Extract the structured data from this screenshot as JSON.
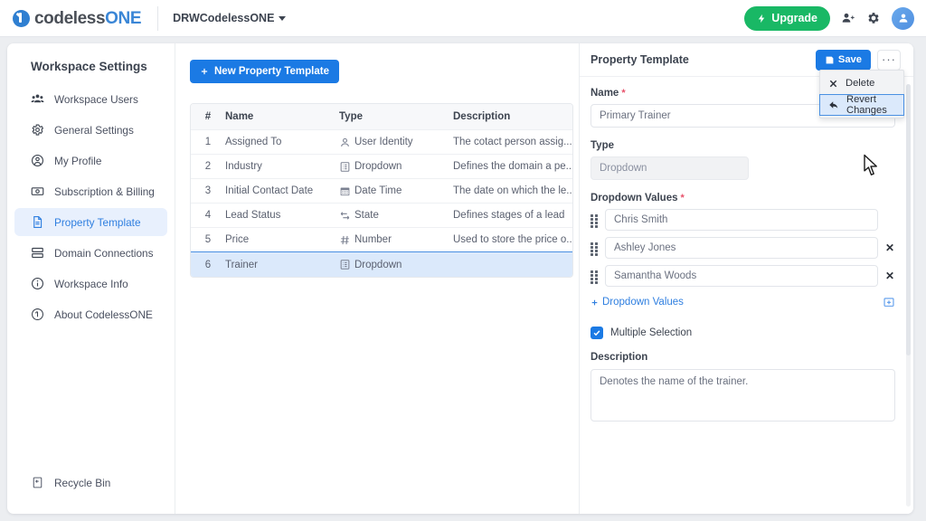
{
  "topbar": {
    "logo_a": "codeless",
    "logo_b": "ONE",
    "logo_icon": "codelessone-logo-icon",
    "workspace_name": "DRWCodelessONE",
    "upgrade_label": "Upgrade",
    "upgrade_icon": "lightning-bolt-icon",
    "invite_icon": "add-user-icon",
    "settings_icon": "gear-icon",
    "avatar_icon": "user-avatar-icon",
    "accent_green": "#19b865",
    "accent_blue": "#1b7ae4"
  },
  "sidebar": {
    "title": "Workspace Settings",
    "items": [
      {
        "label": "Workspace Users",
        "icon": "users-group-icon",
        "active": false
      },
      {
        "label": "General Settings",
        "icon": "gear-icon",
        "active": false
      },
      {
        "label": "My Profile",
        "icon": "user-circle-icon",
        "active": false
      },
      {
        "label": "Subscription & Billing",
        "icon": "banknote-icon",
        "active": false
      },
      {
        "label": "Property Template",
        "icon": "document-icon",
        "active": true
      },
      {
        "label": "Domain Connections",
        "icon": "server-stack-icon",
        "active": false
      },
      {
        "label": "Workspace Info",
        "icon": "info-circle-icon",
        "active": false
      },
      {
        "label": "About CodelessONE",
        "icon": "about-logo-icon",
        "active": false
      }
    ],
    "bottom": {
      "label": "Recycle Bin",
      "icon": "recycle-bin-icon"
    }
  },
  "list": {
    "new_button": "New Property Template",
    "new_button_icon": "plus-icon",
    "columns": [
      "#",
      "Name",
      "Type",
      "Description"
    ],
    "rows": [
      {
        "num": "1",
        "name": "Assigned To",
        "type": "User Identity",
        "type_icon": "user-identity-icon",
        "description": "The cotact person assig...",
        "selected": false
      },
      {
        "num": "2",
        "name": "Industry",
        "type": "Dropdown",
        "type_icon": "dropdown-icon",
        "description": "Defines the domain a pe...",
        "selected": false
      },
      {
        "num": "3",
        "name": "Initial Contact Date",
        "type": "Date Time",
        "type_icon": "calendar-icon",
        "description": "The date on which the le...",
        "selected": false
      },
      {
        "num": "4",
        "name": "Lead Status",
        "type": "State",
        "type_icon": "state-icon",
        "description": "Defines stages of a lead",
        "selected": false
      },
      {
        "num": "5",
        "name": "Price",
        "type": "Number",
        "type_icon": "hash-icon",
        "description": "Used to store the price o...",
        "selected": false
      },
      {
        "num": "6",
        "name": "Trainer",
        "type": "Dropdown",
        "type_icon": "dropdown-icon",
        "description": "",
        "selected": true
      }
    ]
  },
  "detail": {
    "title": "Property Template",
    "save_label": "Save",
    "save_icon": "floppy-disk-icon",
    "more_label": "···",
    "menu": [
      {
        "label": "Delete",
        "icon": "close-x-icon",
        "highlighted": false
      },
      {
        "label": "Revert Changes",
        "icon": "back-arrow-icon",
        "highlighted": true
      }
    ],
    "name_label": "Name",
    "name_required": "*",
    "name_value": "Primary Trainer",
    "type_label": "Type",
    "type_value": "Dropdown",
    "dropdown_values_label": "Dropdown Values",
    "dropdown_values_required": "*",
    "dropdown_values": [
      {
        "value": "Chris Smith",
        "removable": false
      },
      {
        "value": "Ashley Jones",
        "removable": true
      },
      {
        "value": "Samantha Woods",
        "removable": true
      }
    ],
    "add_values_label": "Dropdown Values",
    "add_values_icon": "plus-icon",
    "add_box_icon": "add-box-icon",
    "multiple_selection_label": "Multiple Selection",
    "multiple_selection_checked": true,
    "description_label": "Description",
    "description_value": "Denotes the name of the trainer."
  }
}
